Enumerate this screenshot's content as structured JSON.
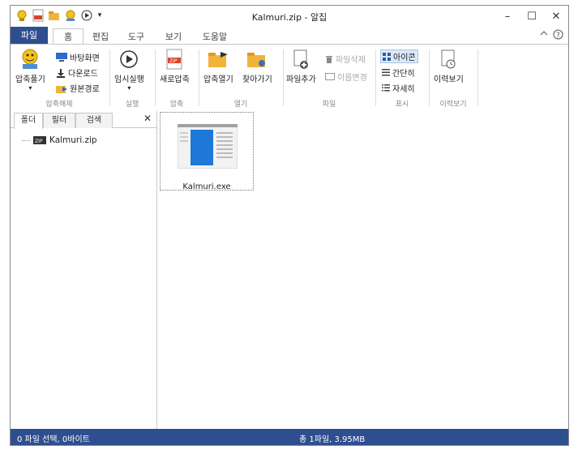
{
  "window": {
    "title": "Kalmuri.zip - 알집",
    "buttons": {
      "minimize": "–",
      "maximize": "☐",
      "close": "✕"
    }
  },
  "quick_access": {
    "more": "▾"
  },
  "tabs": [
    {
      "label": "파일"
    },
    {
      "label": "홈"
    },
    {
      "label": "편집"
    },
    {
      "label": "도구"
    },
    {
      "label": "보기"
    },
    {
      "label": "도움말"
    }
  ],
  "ribbon": {
    "extract": {
      "big_label": "압축풀기",
      "desktop": "바탕화면",
      "downloads": "다운로드",
      "original_path": "원본경로",
      "group": "압축해제"
    },
    "run": {
      "label": "임시실행",
      "group": "실행"
    },
    "compress": {
      "label": "새로압축",
      "group": "압축"
    },
    "open": {
      "open_label": "압축열기",
      "find_label": "찾아가기",
      "group": "열기"
    },
    "file": {
      "add_label": "파일추가",
      "delete_label": "파일삭제",
      "rename_label": "이름변경",
      "group": "파일"
    },
    "view": {
      "icon_label": "아이콘",
      "simple_label": "간단히",
      "detail_label": "자세히",
      "group": "표시"
    },
    "history": {
      "label": "이력보기",
      "group": "이력보기"
    }
  },
  "left_panel": {
    "tabs": [
      {
        "label": "폴더"
      },
      {
        "label": "필터"
      },
      {
        "label": "검색"
      }
    ],
    "close": "✕",
    "tree_item": "Kalmuri.zip",
    "zip_badge": "ZIP"
  },
  "files": [
    {
      "name": "Kalmuri.exe"
    }
  ],
  "status": {
    "selection": "0 파일 선택, 0바이트",
    "total": "총 1파일, 3.95MB"
  },
  "colors": {
    "accent": "#2e4e8f",
    "folder": "#f0b43c",
    "zip_red": "#d9442c"
  }
}
